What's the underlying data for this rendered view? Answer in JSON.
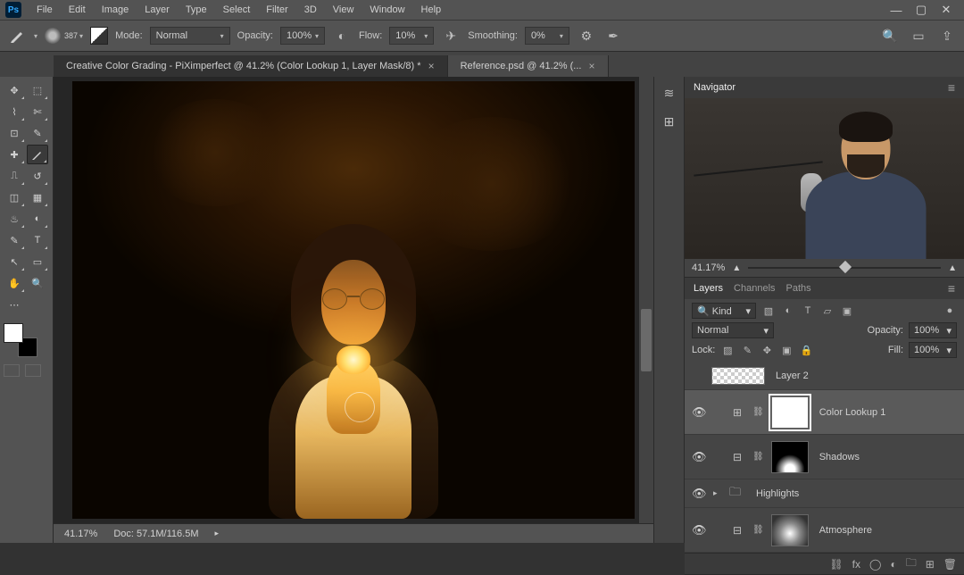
{
  "app": {
    "logo": "Ps"
  },
  "menu": [
    "File",
    "Edit",
    "Image",
    "Layer",
    "Type",
    "Select",
    "Filter",
    "3D",
    "View",
    "Window",
    "Help"
  ],
  "options": {
    "brush_size": "387",
    "mode_label": "Mode:",
    "mode_value": "Normal",
    "opacity_label": "Opacity:",
    "opacity_value": "100%",
    "flow_label": "Flow:",
    "flow_value": "10%",
    "smoothing_label": "Smoothing:",
    "smoothing_value": "0%"
  },
  "tabs": [
    {
      "title": "Creative Color Grading - PiXimperfect @ 41.2% (Color Lookup 1, Layer Mask/8) *",
      "active": true
    },
    {
      "title": "Reference.psd @ 41.2% (...",
      "active": false
    }
  ],
  "status": {
    "zoom": "41.17%",
    "doc": "Doc: 57.1M/116.5M"
  },
  "navigator": {
    "title": "Navigator",
    "zoom": "41.17%"
  },
  "layers_panel": {
    "tabs": [
      "Layers",
      "Channels",
      "Paths"
    ],
    "kind": "Kind",
    "blend": "Normal",
    "opacity_label": "Opacity:",
    "opacity_value": "100%",
    "lock_label": "Lock:",
    "fill_label": "Fill:",
    "fill_value": "100%"
  },
  "layers": [
    {
      "name": "Layer 2",
      "type": "raster"
    },
    {
      "name": "Color Lookup 1",
      "type": "adj",
      "selected": true
    },
    {
      "name": "Shadows",
      "type": "adj"
    },
    {
      "name": "Highlights",
      "type": "group"
    },
    {
      "name": "Atmosphere",
      "type": "adj"
    }
  ]
}
